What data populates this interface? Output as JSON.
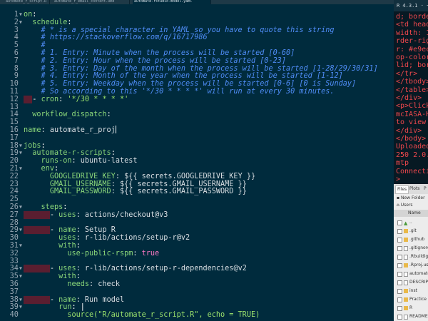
{
  "tabs": [
    {
      "label": "automate_r_script.R"
    },
    {
      "label": "automate_r_email_content.Rmd"
    },
    {
      "label": "automate-rstudio-model.yaml"
    }
  ],
  "editor": {
    "lines": [
      {
        "n": "1",
        "parts": [
          {
            "t": "on",
            "c": "k"
          },
          {
            "t": ":",
            "c": "p"
          }
        ]
      },
      {
        "n": "2",
        "parts": [
          {
            "t": "  "
          },
          {
            "t": "schedule",
            "c": "k"
          },
          {
            "t": ":",
            "c": "p"
          }
        ]
      },
      {
        "n": "3",
        "parts": [
          {
            "t": "    "
          },
          {
            "t": "# * is a special character in YAML so you have to quote this string",
            "c": "c"
          }
        ]
      },
      {
        "n": "4",
        "parts": [
          {
            "t": "    "
          },
          {
            "t": "# https://stackoverflow.com/q/16717986",
            "c": "c"
          }
        ]
      },
      {
        "n": "5",
        "parts": [
          {
            "t": "    "
          },
          {
            "t": "#",
            "c": "c"
          }
        ]
      },
      {
        "n": "6",
        "parts": [
          {
            "t": "    "
          },
          {
            "t": "# 1. Entry: Minute when the process will be started [0-60]",
            "c": "c"
          }
        ]
      },
      {
        "n": "7",
        "parts": [
          {
            "t": "    "
          },
          {
            "t": "# 2. Entry: Hour when the process will be started [0-23]",
            "c": "c"
          }
        ]
      },
      {
        "n": "8",
        "parts": [
          {
            "t": "    "
          },
          {
            "t": "# 3. Entry: Day of the month when the process will be started [1-28/29/30/31]",
            "c": "c"
          }
        ]
      },
      {
        "n": "9",
        "parts": [
          {
            "t": "    "
          },
          {
            "t": "# 4. Entry: Month of the year when the process will be started [1-12]",
            "c": "c"
          }
        ]
      },
      {
        "n": "10",
        "parts": [
          {
            "t": "    "
          },
          {
            "t": "# 5. Entry: Weekday when the process will be started [0-6] [0 is Sunday]",
            "c": "c"
          }
        ]
      },
      {
        "n": "11",
        "parts": [
          {
            "t": "    "
          },
          {
            "t": "# So according to this '*/30 * * * *' will run at every 30 minutes.",
            "c": "c"
          }
        ]
      },
      {
        "n": "12",
        "parts": [
          {
            "t": "  ",
            "c": "hl"
          },
          {
            "t": "- ",
            "c": "p"
          },
          {
            "t": "cron",
            "c": "k"
          },
          {
            "t": ": ",
            "c": "p"
          },
          {
            "t": "'*/30 * * * *'",
            "c": "s"
          }
        ]
      },
      {
        "n": "13",
        "parts": []
      },
      {
        "n": "14",
        "parts": [
          {
            "t": "  "
          },
          {
            "t": "workflow_dispatch",
            "c": "k"
          },
          {
            "t": ":",
            "c": "p"
          }
        ]
      },
      {
        "n": "15",
        "parts": []
      },
      {
        "n": "16",
        "parts": [
          {
            "t": "name",
            "c": "k"
          },
          {
            "t": ": automate_r_proj"
          },
          {
            "t": "",
            "c": "cursor"
          }
        ]
      },
      {
        "n": "17",
        "parts": []
      },
      {
        "n": "18",
        "parts": [
          {
            "t": "jobs",
            "c": "k"
          },
          {
            "t": ":",
            "c": "p"
          }
        ]
      },
      {
        "n": "19",
        "parts": [
          {
            "t": "  "
          },
          {
            "t": "automate-r-scripts",
            "c": "k"
          },
          {
            "t": ":",
            "c": "p"
          }
        ]
      },
      {
        "n": "20",
        "parts": [
          {
            "t": "    "
          },
          {
            "t": "runs-on",
            "c": "k"
          },
          {
            "t": ": ubuntu-latest"
          }
        ]
      },
      {
        "n": "21",
        "parts": [
          {
            "t": "    "
          },
          {
            "t": "env",
            "c": "k"
          },
          {
            "t": ":",
            "c": "p"
          }
        ]
      },
      {
        "n": "22",
        "parts": [
          {
            "t": "      "
          },
          {
            "t": "GOOGLEDRIVE_KEY",
            "c": "k"
          },
          {
            "t": ": ${{ secrets.GOOGLEDRIVE_KEY }}"
          }
        ]
      },
      {
        "n": "23",
        "parts": [
          {
            "t": "      "
          },
          {
            "t": "GMAIL_USERNAME",
            "c": "k"
          },
          {
            "t": ": ${{ secrets.GMAIL_USERNAME }}"
          }
        ]
      },
      {
        "n": "24",
        "parts": [
          {
            "t": "      "
          },
          {
            "t": "GMAIL_PASSWORD",
            "c": "k"
          },
          {
            "t": ": ${{ secrets.GMAIL_PASSWORD }}"
          }
        ]
      },
      {
        "n": "25",
        "parts": []
      },
      {
        "n": "26",
        "parts": [
          {
            "t": "    "
          },
          {
            "t": "steps",
            "c": "k"
          },
          {
            "t": ":",
            "c": "p"
          }
        ]
      },
      {
        "n": "27",
        "parts": [
          {
            "t": "      ",
            "c": "hl"
          },
          {
            "t": "- ",
            "c": "p"
          },
          {
            "t": "uses",
            "c": "k"
          },
          {
            "t": ": actions/checkout@v3"
          }
        ]
      },
      {
        "n": "28",
        "parts": []
      },
      {
        "n": "29",
        "parts": [
          {
            "t": "      ",
            "c": "hl"
          },
          {
            "t": "- ",
            "c": "p"
          },
          {
            "t": "name",
            "c": "k"
          },
          {
            "t": ": Setup R"
          }
        ]
      },
      {
        "n": "30",
        "parts": [
          {
            "t": "        "
          },
          {
            "t": "uses",
            "c": "k"
          },
          {
            "t": ": r-lib/actions/setup-r@v2"
          }
        ]
      },
      {
        "n": "31",
        "parts": [
          {
            "t": "        "
          },
          {
            "t": "with",
            "c": "k"
          },
          {
            "t": ":",
            "c": "p"
          }
        ]
      },
      {
        "n": "32",
        "parts": [
          {
            "t": "          "
          },
          {
            "t": "use-public-rspm",
            "c": "k"
          },
          {
            "t": ": "
          },
          {
            "t": "true",
            "c": "b"
          }
        ]
      },
      {
        "n": "33",
        "parts": []
      },
      {
        "n": "34",
        "parts": [
          {
            "t": "      ",
            "c": "hl"
          },
          {
            "t": "- ",
            "c": "p"
          },
          {
            "t": "uses",
            "c": "k"
          },
          {
            "t": ": r-lib/actions/setup-r-dependencies@v2"
          }
        ]
      },
      {
        "n": "35",
        "parts": [
          {
            "t": "        "
          },
          {
            "t": "with",
            "c": "k"
          },
          {
            "t": ":",
            "c": "p"
          }
        ]
      },
      {
        "n": "36",
        "parts": [
          {
            "t": "          "
          },
          {
            "t": "needs",
            "c": "k"
          },
          {
            "t": ": check"
          }
        ]
      },
      {
        "n": "37",
        "parts": []
      },
      {
        "n": "38",
        "parts": [
          {
            "t": "      ",
            "c": "hl"
          },
          {
            "t": "- ",
            "c": "p"
          },
          {
            "t": "name",
            "c": "k"
          },
          {
            "t": ": Run model"
          }
        ]
      },
      {
        "n": "39",
        "parts": [
          {
            "t": "        "
          },
          {
            "t": "run",
            "c": "k"
          },
          {
            "t": ": |",
            "c": "p"
          }
        ]
      },
      {
        "n": "40",
        "parts": [
          {
            "t": "          "
          },
          {
            "t": "source(\"R/automate_r_script.R\", echo = TRUE)",
            "c": "s"
          }
        ]
      }
    ]
  },
  "console": {
    "header": "R 4.3.1 · ~/",
    "lines": [
      {
        "t": "d; border",
        "c": "red"
      },
      {
        "t": "<td heade",
        "c": "red"
      },
      {
        "t": "width: 1",
        "c": "red"
      },
      {
        "t": "rder-righ",
        "c": "red"
      },
      {
        "t": "r: #e9ec",
        "c": "red"
      },
      {
        "t": "op-color",
        "c": "red"
      },
      {
        "t": "lid; bor",
        "c": "red"
      },
      {
        "t": "</tr>",
        "c": "red"
      },
      {
        "t": "</tbody>",
        "c": "red"
      },
      {
        "t": "</table>",
        "c": "red"
      },
      {
        "t": "</div>",
        "c": "red"
      },
      {
        "t": "<p>Click",
        "c": "red"
      },
      {
        "t": "mcIASA-H",
        "c": "red"
      },
      {
        "t": "to view",
        "c": "red"
      },
      {
        "t": "</div>",
        "c": "red"
      },
      {
        "t": "</body>",
        "c": "red"
      },
      {
        "t": "Uploaded",
        "c": "red"
      },
      {
        "t": "250 2.0.",
        "c": "red"
      },
      {
        "t": "mtp",
        "c": "red"
      },
      {
        "t": "Connecti",
        "c": "red"
      },
      {
        "t": ">",
        "c": "red"
      }
    ]
  },
  "files_pane": {
    "tabs": [
      "Files",
      "Plots",
      "P"
    ],
    "new_folder": "New Folder",
    "breadcrumb": "Users",
    "name_header": "Name",
    "items": [
      {
        "name": "..",
        "type": "up"
      },
      {
        "name": ".git",
        "type": "folder"
      },
      {
        "name": ".github",
        "type": "folder"
      },
      {
        "name": ".gitignore",
        "type": "file"
      },
      {
        "name": ".Rbuildignore",
        "type": "file"
      },
      {
        "name": ".Rproj.user",
        "type": "folder"
      },
      {
        "name": "automate",
        "type": "file"
      },
      {
        "name": "DESCRIPTION",
        "type": "file"
      },
      {
        "name": "inst",
        "type": "folder"
      },
      {
        "name": "Practice",
        "type": "folder"
      },
      {
        "name": "R",
        "type": "folder"
      },
      {
        "name": "README",
        "type": "file"
      }
    ]
  }
}
